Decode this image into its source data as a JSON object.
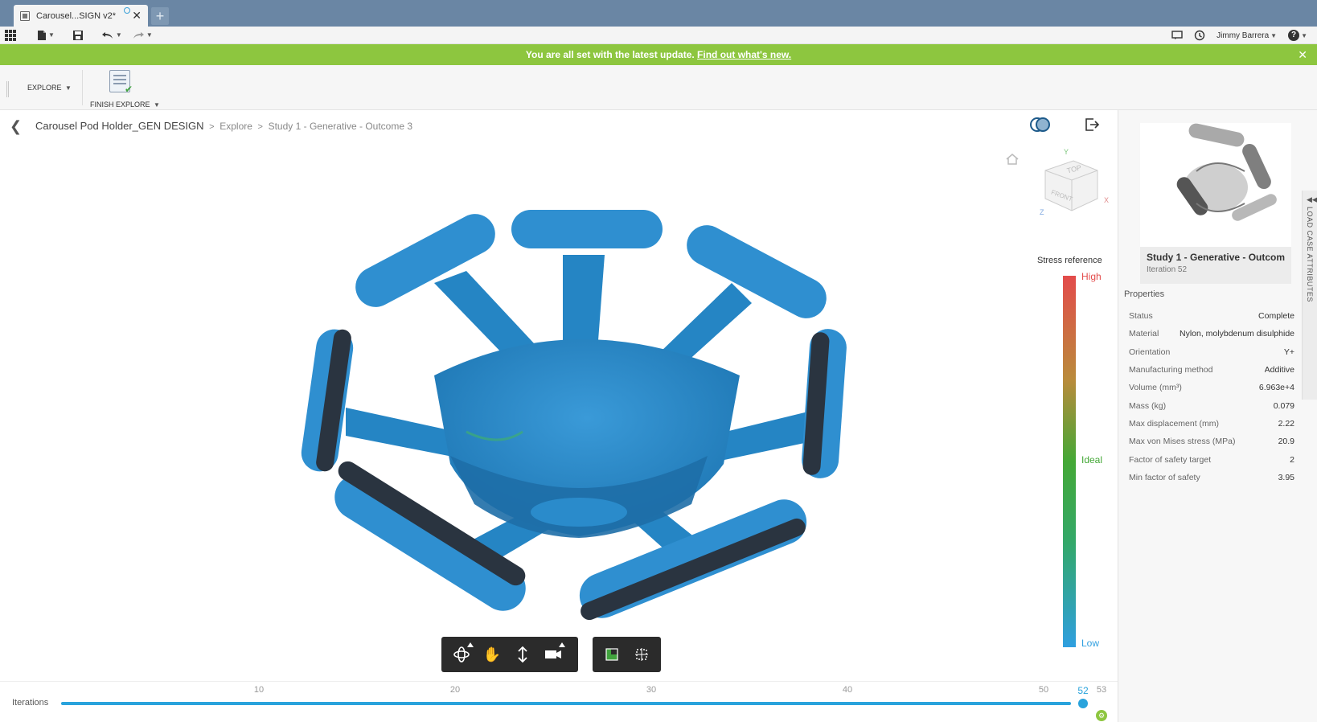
{
  "tab": {
    "title": "Carousel...SIGN v2*",
    "new_tab": "+"
  },
  "qat": {
    "user": "Jimmy Barrera",
    "help": "?"
  },
  "banner": {
    "message": "You are all set with the latest update.",
    "link": "Find out what's new."
  },
  "ribbon": {
    "workspace": "EXPLORE",
    "finish": "FINISH EXPLORE"
  },
  "breadcrumb": {
    "root": "Carousel Pod Holder_GEN DESIGN",
    "items": [
      "Explore",
      "Study 1 - Generative - Outcome 3"
    ]
  },
  "viewcube": {
    "top": "TOP",
    "front": "FRONT",
    "axis_x": "X",
    "axis_y": "Y",
    "axis_z": "Z"
  },
  "stress": {
    "title": "Stress reference",
    "high": "High",
    "ideal": "Ideal",
    "low": "Low",
    "colors": [
      "#e34b4b",
      "#44a836",
      "#2f9fe0"
    ]
  },
  "timeline": {
    "label": "Iterations",
    "ticks": [
      "10",
      "20",
      "30",
      "40",
      "50"
    ],
    "current": "52",
    "max": "53",
    "min_iteration": 0,
    "max_iteration": 53,
    "current_iteration": 52
  },
  "panel": {
    "thumb_title": "Study 1 - Generative - Outcom...",
    "thumb_sub": "Iteration 52",
    "side_tab": "LOAD CASE ATTRIBUTES",
    "properties_title": "Properties",
    "properties": [
      {
        "key": "Status",
        "value": "Complete"
      },
      {
        "key": "Material",
        "value": "Nylon, molybdenum disulphide"
      },
      {
        "key": "Orientation",
        "value": "Y+"
      },
      {
        "key": "Manufacturing method",
        "value": "Additive"
      },
      {
        "key": "Volume (mm³)",
        "value": "6.963e+4"
      },
      {
        "key": "Mass (kg)",
        "value": "0.079"
      },
      {
        "key": "Max displacement (mm)",
        "value": "2.22"
      },
      {
        "key": "Max von Mises stress (MPa)",
        "value": "20.9"
      },
      {
        "key": "Factor of safety target",
        "value": "2"
      },
      {
        "key": "Min factor of safety",
        "value": "3.95"
      }
    ]
  },
  "colors": {
    "model": "#2f8fd0",
    "accent": "#29a3dc",
    "banner": "#8dc63f",
    "titlebar": "#6a86a4"
  }
}
